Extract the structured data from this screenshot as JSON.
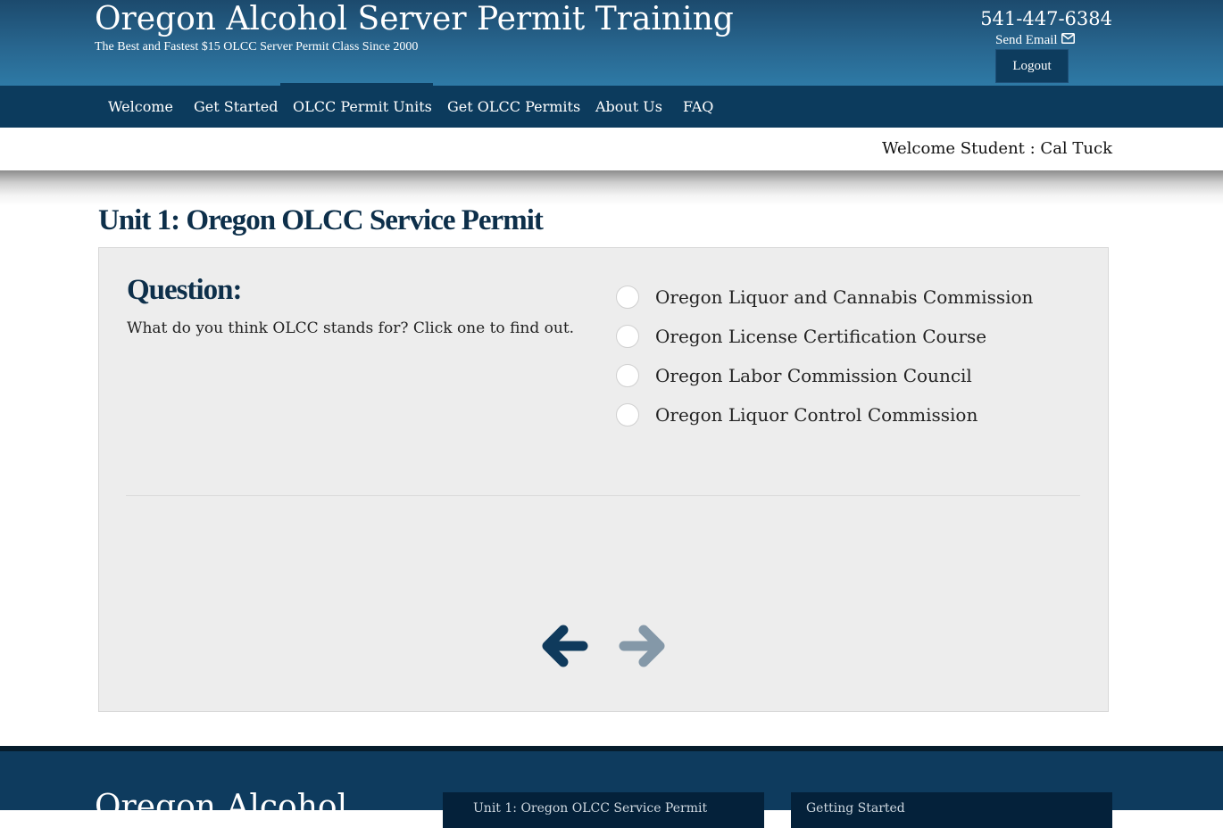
{
  "header": {
    "site_title": "Oregon Alcohol Server Permit Training",
    "tagline": "The Best and Fastest $15 OLCC Server Permit Class Since 2000",
    "phone": "541-447-6384",
    "send_email_label": "Send Email",
    "logout_label": "Logout"
  },
  "nav": {
    "items": [
      {
        "label": "Welcome"
      },
      {
        "label": "Get Started"
      },
      {
        "label": "OLCC Permit Units"
      },
      {
        "label": "Get OLCC Permits"
      },
      {
        "label": "About Us"
      },
      {
        "label": "FAQ"
      }
    ],
    "active": "OLCC Permit Units"
  },
  "welcome": {
    "text": "Welcome Student : Cal Tuck"
  },
  "main": {
    "unit_title": "Unit 1: Oregon OLCC Service Permit",
    "question_heading": "Question:",
    "question_text": "What do you think OLCC stands for? Click one to find out.",
    "options": [
      {
        "label": "Oregon Liquor and Cannabis Commission"
      },
      {
        "label": "Oregon License Certification Course"
      },
      {
        "label": "Oregon Labor Commission Council"
      },
      {
        "label": "Oregon Liquor Control Commission"
      }
    ],
    "prev_icon": "arrow-left-icon",
    "next_icon": "arrow-right-icon"
  },
  "footer": {
    "title": "Oregon Alcohol",
    "box1_text": "Unit 1: Oregon OLCC Service Permit",
    "box2_text": "Getting Started"
  },
  "colors": {
    "header_top": "#1c4a6d",
    "header_bottom": "#2e7aa6",
    "navbar": "#0c3b5d",
    "title_navy": "#0d2f4a",
    "card_bg": "#ededed",
    "arrow_active": "#0f3a5c",
    "arrow_inactive": "#8498a8",
    "footer_bg": "#0e3b5e"
  }
}
